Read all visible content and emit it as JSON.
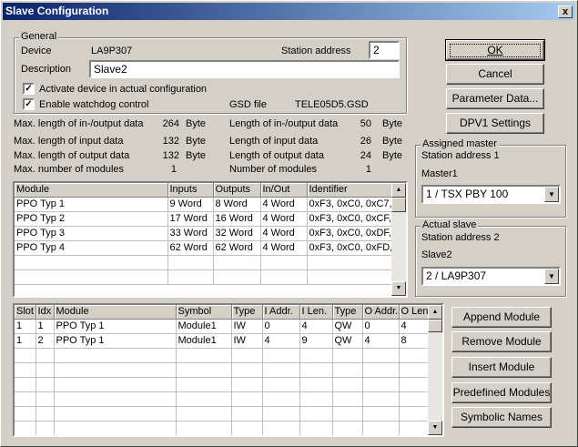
{
  "window": {
    "title": "Slave Configuration",
    "close": "x"
  },
  "general": {
    "legend": "General",
    "device_label": "Device",
    "device_value": "LA9P307",
    "station_address_label": "Station address",
    "station_address_value": "2",
    "description_label": "Description",
    "description_value": "Slave2",
    "activate_label": "Activate device in actual configuration",
    "activate_checked": "✓",
    "watchdog_label": "Enable watchdog control",
    "watchdog_checked": "✓",
    "gsd_label": "GSD file",
    "gsd_value": "TELE05D5.GSD"
  },
  "stats": {
    "left": [
      {
        "label": "Max. length of in-/output data",
        "value": "264",
        "unit": "Byte"
      },
      {
        "label": "Max. length of input data",
        "value": "132",
        "unit": "Byte"
      },
      {
        "label": "Max. length of output data",
        "value": "132",
        "unit": "Byte"
      },
      {
        "label": "Max. number of modules",
        "value": "1",
        "unit": ""
      }
    ],
    "right": [
      {
        "label": "Length of in-/output data",
        "value": "50",
        "unit": "Byte"
      },
      {
        "label": "Length of input data",
        "value": "26",
        "unit": "Byte"
      },
      {
        "label": "Length of output data",
        "value": "24",
        "unit": "Byte"
      },
      {
        "label": "Number of modules",
        "value": "1",
        "unit": ""
      }
    ]
  },
  "buttons": {
    "ok": "OK",
    "cancel": "Cancel",
    "parameter_data": "Parameter Data...",
    "dpv1_settings": "DPV1 Settings",
    "append_module": "Append Module",
    "remove_module": "Remove Module",
    "insert_module": "Insert Module",
    "predefined_modules": "Predefined Modules",
    "symbolic_names": "Symbolic Names"
  },
  "assigned_master": {
    "legend": "Assigned master",
    "station_address": "Station address 1",
    "name": "Master1",
    "selected": "1 / TSX PBY 100"
  },
  "actual_slave": {
    "legend": "Actual slave",
    "station_address": "Station address 2",
    "name": "Slave2",
    "selected": "2 / LA9P307"
  },
  "module_table": {
    "headers": [
      "Module",
      "Inputs",
      "Outputs",
      "In/Out",
      "Identifier"
    ],
    "rows": [
      [
        "PPO Typ 1",
        "9 Word",
        "8 Word",
        "4 Word",
        "0xF3, 0xC0, 0xC7,"
      ],
      [
        "PPO Typ 2",
        "17 Word",
        "16 Word",
        "4 Word",
        "0xF3, 0xC0, 0xCF,"
      ],
      [
        "PPO Typ 3",
        "33 Word",
        "32 Word",
        "4 Word",
        "0xF3, 0xC0, 0xDF,"
      ],
      [
        "PPO Typ 4",
        "62 Word",
        "62 Word",
        "4 Word",
        "0xF3, 0xC0, 0xFD,"
      ]
    ]
  },
  "slot_table": {
    "headers": [
      "Slot",
      "Idx",
      "Module",
      "Symbol",
      "Type",
      "I Addr.",
      "I Len.",
      "Type",
      "O Addr.",
      "O Len"
    ],
    "rows": [
      [
        "1",
        "1",
        "PPO Typ 1",
        "Module1",
        "IW",
        "0",
        "4",
        "QW",
        "0",
        "4"
      ],
      [
        "1",
        "2",
        "PPO Typ 1",
        "Module1",
        "IW",
        "4",
        "9",
        "QW",
        "4",
        "8"
      ]
    ]
  },
  "icons": {
    "scroll_up": "▲",
    "scroll_down": "▼",
    "dropdown": "▼"
  }
}
